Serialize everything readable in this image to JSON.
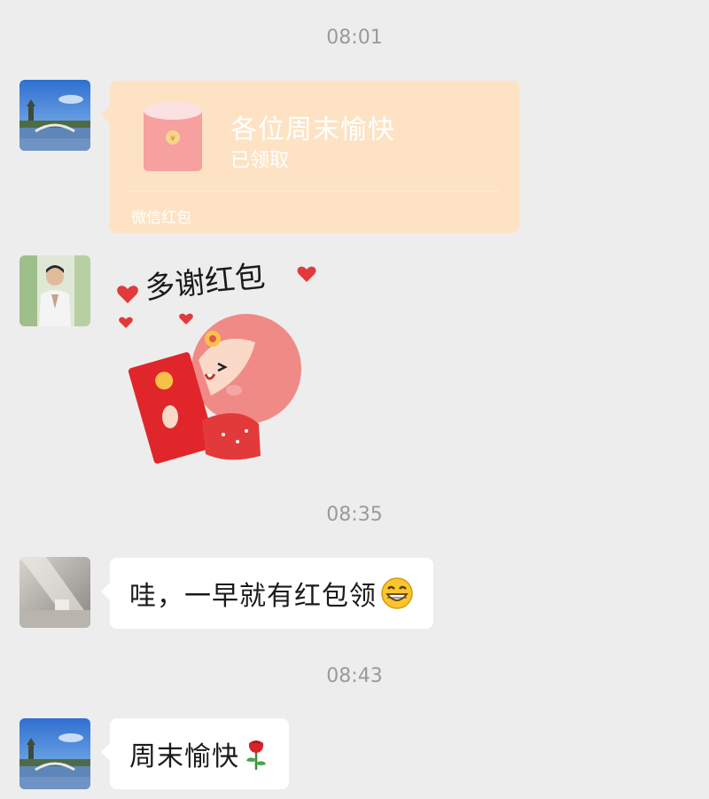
{
  "chat": {
    "messages": [
      {
        "time": "08:01"
      },
      {
        "redpacket_title": "各位周末愉快",
        "redpacket_status": "已领取",
        "redpacket_footer": "微信红包"
      },
      {
        "sticker_text": "多谢红包"
      },
      {
        "time": "08:35"
      },
      {
        "text": "哇，一早就有红包领",
        "emoji": "grinning-emoji"
      },
      {
        "time": "08:43"
      },
      {
        "text": "周末愉快",
        "emoji": "rose-emoji"
      }
    ]
  },
  "colors": {
    "background": "#ededed",
    "redpacket_bg": "#fde3c4",
    "bubble_bg": "#ffffff"
  }
}
